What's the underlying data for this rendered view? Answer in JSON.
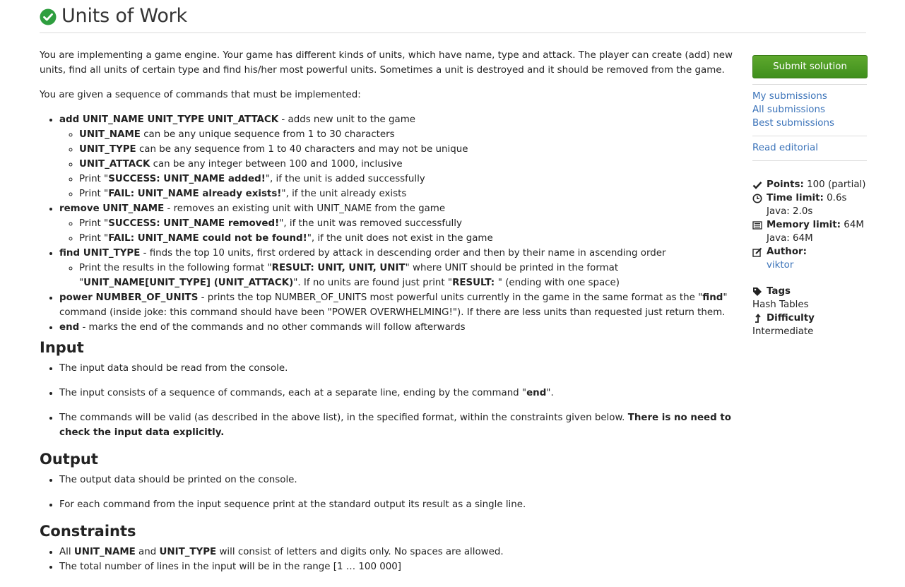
{
  "page": {
    "title": "Units of Work"
  },
  "statement": {
    "intro": "You are implementing a game engine. Your game has different kinds of units, which have name, type and attack. The player can create (add) new units, find all units of certain type and find his/her most powerful units. Sometimes a unit is destroyed and it should be removed from the game.",
    "commands_intro": "You are given a sequence of commands that must be implemented:",
    "add": {
      "cmd": "add UNIT_NAME UNIT_TYPE UNIT_ATTACK",
      "desc": " - adds new unit to the game",
      "sub": [
        {
          "b": "UNIT_NAME",
          "t": " can be any unique sequence from 1 to 30 characters"
        },
        {
          "b": "UNIT_TYPE",
          "t": " can be any sequence from 1 to 40 characters and may not be unique"
        },
        {
          "b": "UNIT_ATTACK",
          "t": " can be any integer between 100 and 1000, inclusive"
        }
      ],
      "print_success": {
        "pre": "Print \"",
        "b": "SUCCESS: UNIT_NAME added!",
        "post": "\", if the unit is added successfully"
      },
      "print_fail": {
        "pre": "Print \"",
        "b": "FAIL: UNIT_NAME already exists!",
        "post": "\", if the unit already exists"
      }
    },
    "remove": {
      "cmd": "remove UNIT_NAME",
      "desc": " - removes an existing unit with UNIT_NAME from the game",
      "print_success": {
        "pre": "Print \"",
        "b": "SUCCESS: UNIT_NAME removed!",
        "post": "\", if the unit was removed successfully"
      },
      "print_fail": {
        "pre": "Print \"",
        "b": "FAIL: UNIT_NAME could not be found!",
        "post": "\", if the unit does not exist in the game"
      }
    },
    "find": {
      "cmd": "find UNIT_TYPE",
      "desc": " - finds the top 10 units, first ordered by attack in descending order and then by their name in ascending order",
      "p1": "Print the results in the following format \"",
      "b1": "RESULT: UNIT, UNIT, UNIT",
      "p2": "\" where UNIT should be printed in the format \"",
      "b2": "UNIT_NAME[UNIT_TYPE] (UNIT_ATTACK)",
      "p3": "\". If no units are found just print \"",
      "b3": "RESULT: ",
      "p4": "\" (ending with one space)"
    },
    "power": {
      "cmd": "power NUMBER_OF_UNITS",
      "desc1": " - prints the top NUMBER_OF_UNITS most powerful units currently in the game in the same format as the \"",
      "desc_b": "find",
      "desc2": "\" command (inside joke: this command should have been \"POWER OVERWHELMING!\"). If there are less units than requested just return them."
    },
    "end": {
      "cmd": "end",
      "desc": " - marks the end of the commands and no other commands will follow afterwards"
    }
  },
  "input": {
    "heading": "Input",
    "item1": "The input data should be read from the console.",
    "item2_pre": "The input consists of a sequence of commands, each at a separate line, ending by the command \"",
    "item2_b": "end",
    "item2_post": "\".",
    "item3_pre": "The commands will be valid (as described in the above list), in the specified format, within the constraints given below. ",
    "item3_b": "There is no need to check the input data explicitly."
  },
  "output": {
    "heading": "Output",
    "item1": "The output data should be printed on the console.",
    "item2": "For each command from the input sequence print at the standard output its result as a single line."
  },
  "constraints": {
    "heading": "Constraints",
    "item1_pre": "All ",
    "item1_b1": "UNIT_NAME",
    "item1_mid": " and ",
    "item1_b2": "UNIT_TYPE",
    "item1_post": " will consist of letters and digits only. No spaces are allowed.",
    "item2": "The total number of lines in the input will be in the range [1 … 100 000]"
  },
  "sidebar": {
    "submit_label": "Submit solution",
    "my_submissions": "My submissions",
    "all_submissions": "All submissions",
    "best_submissions": "Best submissions",
    "read_editorial": "Read editorial",
    "points_label": "Points:",
    "points_value": " 100 (partial)",
    "time_label": "Time limit:",
    "time_value": " 0.6s",
    "time_java": "Java: 2.0s",
    "memory_label": "Memory limit:",
    "memory_value": " 64M",
    "memory_java": "Java: 64M",
    "author_label": "Author:",
    "author_name": "viktor",
    "tags_label": "Tags",
    "tags_value": "Hash Tables",
    "difficulty_label": "Difficulty",
    "difficulty_value": "Intermediate"
  },
  "colors": {
    "accent_green": "#3f8f1c",
    "link_blue": "#3b73b9",
    "check_green": "#2e9e3f"
  }
}
